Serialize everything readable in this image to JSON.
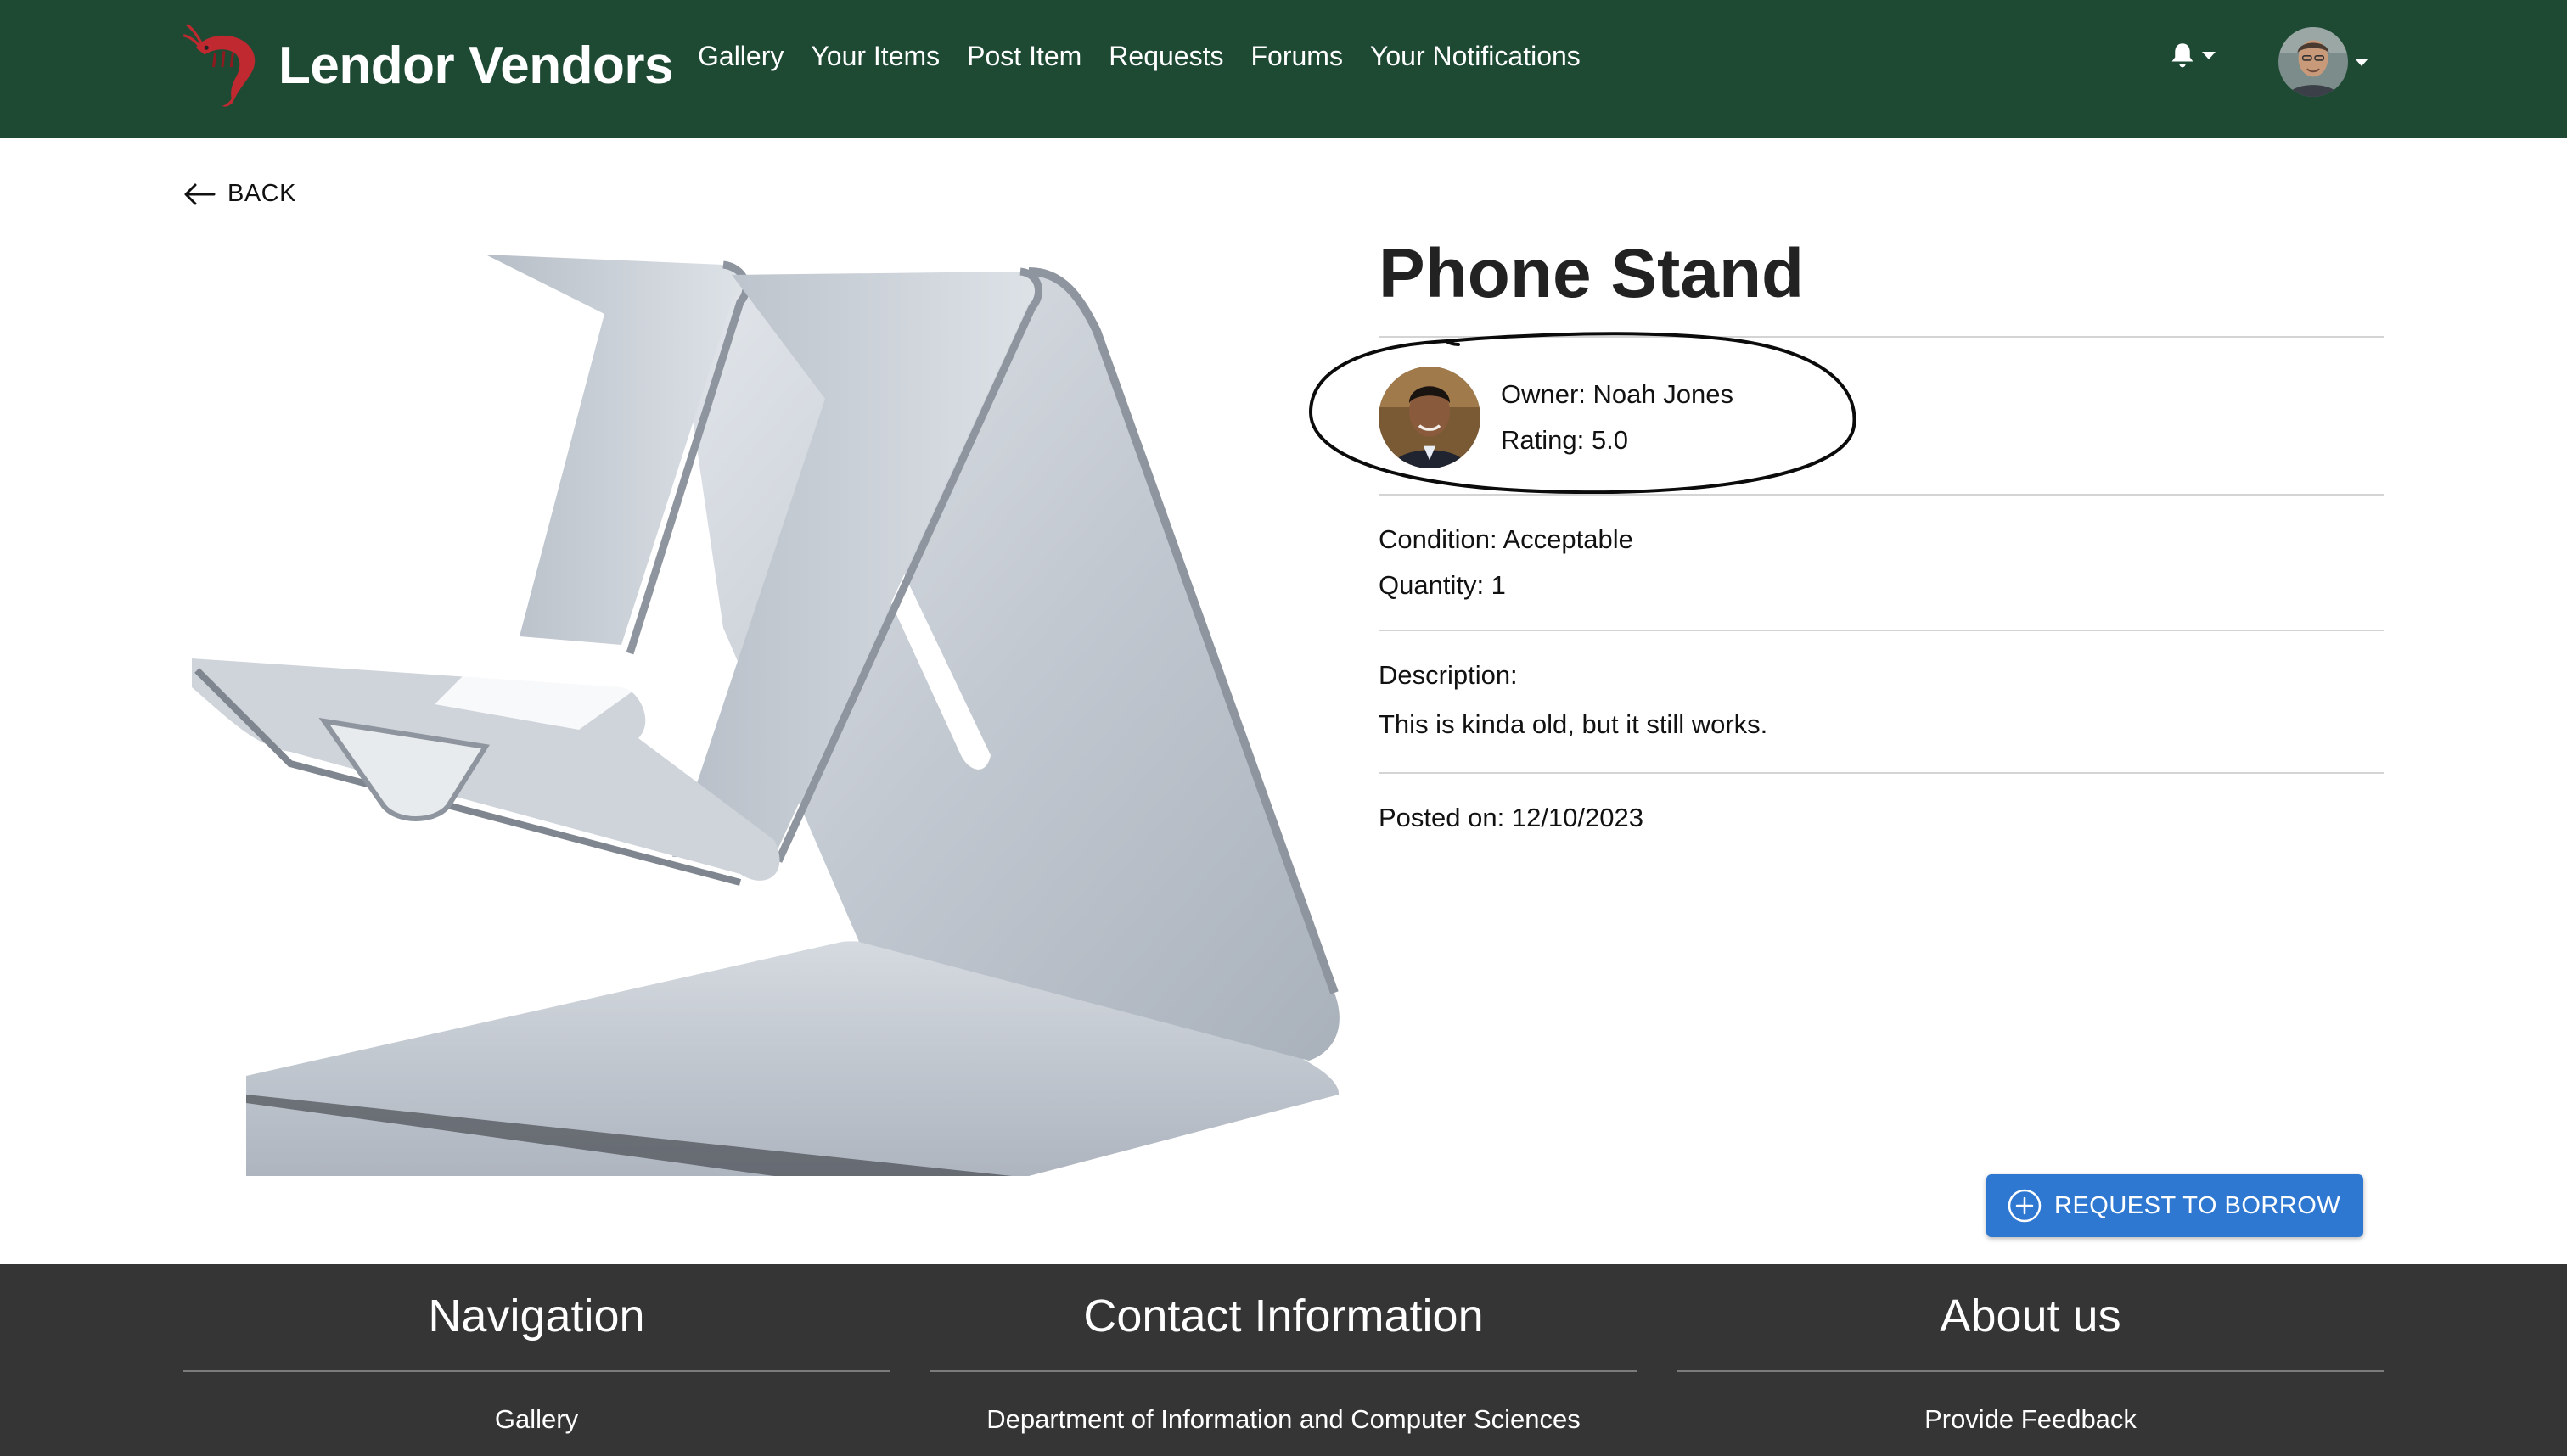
{
  "navbar": {
    "brand": "Lendor Vendors",
    "links": [
      "Gallery",
      "Your Items",
      "Post Item",
      "Requests",
      "Forums",
      "Your Notifications"
    ]
  },
  "back": {
    "label": "BACK"
  },
  "item": {
    "title": "Phone Stand",
    "owner": "Owner: Noah Jones",
    "rating": "Rating: 5.0",
    "condition": "Condition: Acceptable",
    "quantity": "Quantity: 1",
    "description_label": "Description:",
    "description": "This is kinda old, but it still works.",
    "posted_on": "Posted on: 12/10/2023"
  },
  "actions": {
    "request_label": "REQUEST TO BORROW"
  },
  "footer": {
    "navigation": {
      "title": "Navigation",
      "first_item": "Gallery"
    },
    "contact": {
      "title": "Contact Information",
      "first_item": "Department of Information and Computer Sciences"
    },
    "about": {
      "title": "About us",
      "first_item": "Provide Feedback"
    }
  },
  "colors": {
    "navbar_bg": "#1e4a34",
    "footer_bg": "#353535",
    "primary_button": "#2e78d2",
    "logo_shrimp": "#c0292f"
  },
  "icons": [
    "shrimp-logo-icon",
    "bell-icon",
    "arrow-left-icon",
    "plus-circle-icon"
  ]
}
